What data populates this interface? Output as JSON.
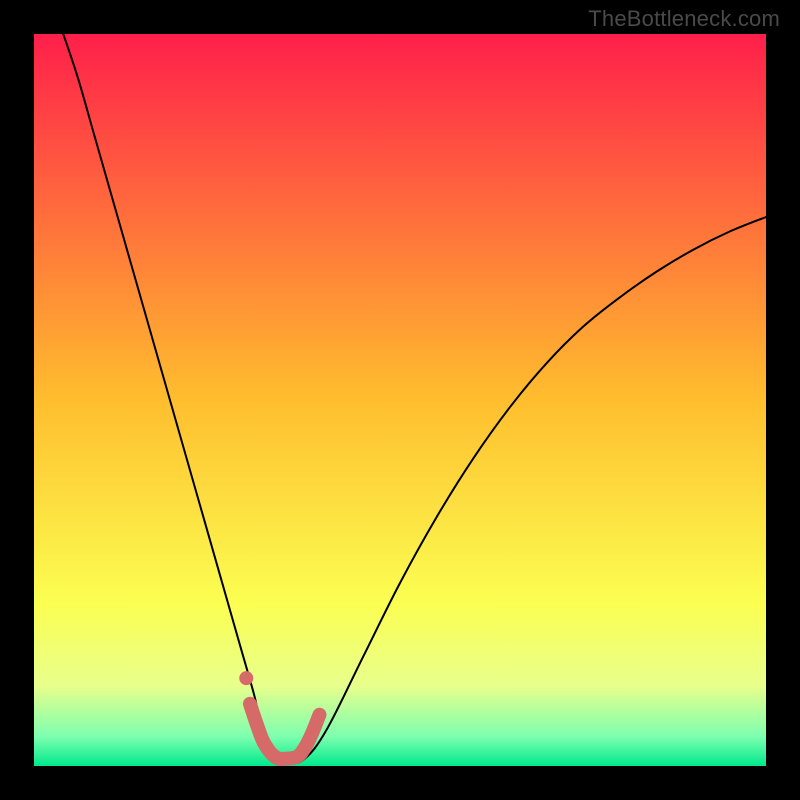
{
  "watermark": "TheBottleneck.com",
  "chart_data": {
    "type": "line",
    "title": "",
    "xlabel": "",
    "ylabel": "",
    "xlim": [
      0,
      100
    ],
    "ylim": [
      0,
      100
    ],
    "grid": false,
    "legend": false,
    "background": {
      "gradient_stops": [
        {
          "pct": 0,
          "color": "#ff1f4a"
        },
        {
          "pct": 50,
          "color": "#ffbe2e"
        },
        {
          "pct": 78,
          "color": "#fbff52"
        },
        {
          "pct": 89,
          "color": "#e8ff8c"
        },
        {
          "pct": 96,
          "color": "#7dffaf"
        },
        {
          "pct": 100,
          "color": "#00e98c"
        }
      ]
    },
    "series": [
      {
        "name": "bottleneck-curve",
        "color": "#000000",
        "x": [
          4,
          6,
          8,
          10,
          12,
          14,
          16,
          18,
          20,
          22,
          24,
          26,
          28,
          30,
          31,
          33,
          35,
          37,
          40,
          45,
          50,
          55,
          60,
          65,
          70,
          75,
          80,
          85,
          90,
          95,
          100
        ],
        "y": [
          100,
          94,
          87,
          80,
          73,
          66,
          59,
          52,
          45,
          38,
          31,
          24,
          17,
          10,
          6,
          1,
          0.5,
          1,
          5,
          15,
          25,
          34,
          42,
          49,
          55,
          60,
          64,
          67.5,
          70.5,
          73,
          75
        ]
      },
      {
        "name": "highlight-basin",
        "color": "#d66a68",
        "stroke_width": 14,
        "x": [
          29.5,
          30.5,
          31.5,
          33,
          34.5,
          36,
          37,
          38,
          39
        ],
        "y": [
          8.5,
          5.5,
          3,
          1.2,
          1,
          1.3,
          2.5,
          4.5,
          7
        ]
      },
      {
        "name": "highlight-dot",
        "color": "#d66a68",
        "marker": "circle",
        "x": [
          29
        ],
        "y": [
          12
        ]
      }
    ]
  }
}
